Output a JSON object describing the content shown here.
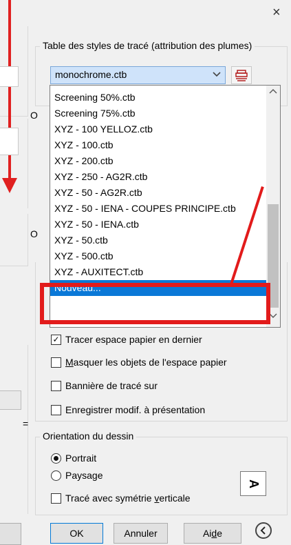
{
  "window": {
    "close_label": "×"
  },
  "pen_table": {
    "title_pre": "Table des styles de tracé ",
    "title_accel": "(",
    "title_post": "attribution des plumes)",
    "selected": "monochrome.ctb"
  },
  "left_fragments": {
    "o1": "O",
    "o2": "O",
    "equals": "="
  },
  "dropdown": {
    "items": [
      {
        "label": "Screening 50%.ctb"
      },
      {
        "label": "Screening 75%.ctb"
      },
      {
        "label": "XYZ - 100 YELLOZ.ctb"
      },
      {
        "label": "XYZ - 100.ctb"
      },
      {
        "label": "XYZ - 200.ctb"
      },
      {
        "label": "XYZ - 250 - AG2R.ctb"
      },
      {
        "label": "XYZ - 50 - AG2R.ctb"
      },
      {
        "label": "XYZ - 50 - IENA - COUPES PRINCIPE.ctb"
      },
      {
        "label": "XYZ - 50 - IENA.ctb"
      },
      {
        "label": "XYZ - 50.ctb"
      },
      {
        "label": "XYZ - 500.ctb"
      },
      {
        "label": "XYZ - AUXITECT.ctb"
      },
      {
        "label": "Nouveau..."
      }
    ],
    "selected_index": 12
  },
  "options": {
    "items": [
      {
        "label_pre": "Tracer espace papier en dernier",
        "accel": "",
        "label_post": "",
        "checked": true,
        "check_mark": "✓"
      },
      {
        "label_pre": "",
        "accel": "M",
        "label_post": "asquer les objets de l'espace papier",
        "checked": false,
        "check_mark": ""
      },
      {
        "label_pre": "Bannière de tracé sur",
        "accel": "",
        "label_post": "",
        "checked": false,
        "check_mark": ""
      },
      {
        "label_pre": "Enre",
        "accel": "g",
        "label_post": "istrer modif. à présentation",
        "checked": false,
        "check_mark": ""
      }
    ]
  },
  "orientation": {
    "title": "Orientation du dessin",
    "portrait": "Portrait",
    "landscape": "Paysage",
    "selected": "Portrait",
    "mirror_pre": "Tracé avec symétrie ",
    "mirror_accel": "v",
    "mirror_post": "erticale",
    "mirror_checked": false,
    "icon_glyph": "A"
  },
  "buttons": {
    "ok": "OK",
    "cancel": "Annuler",
    "help_pre": "Ai",
    "help_accel": "d",
    "help_post": "e",
    "collapse_glyph": "<"
  },
  "colors": {
    "selection": "#0a78d7",
    "annotation_red": "#e21b1b",
    "combo_bg": "#cfe3fa"
  }
}
